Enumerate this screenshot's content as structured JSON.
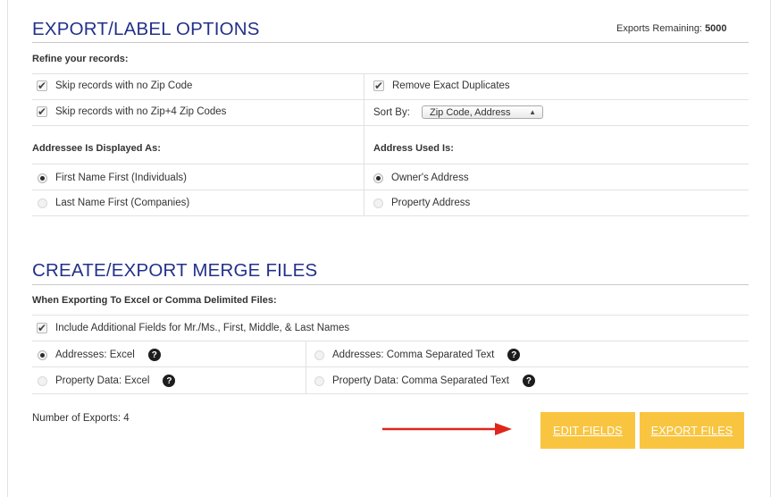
{
  "export_options": {
    "title": "EXPORT/LABEL OPTIONS",
    "exports_remaining_label": "Exports Remaining:",
    "exports_remaining_value": "5000",
    "refine_heading": "Refine your records:",
    "skip_no_zip": "Skip records with no Zip Code",
    "skip_no_zip4": "Skip records with no Zip+4 Zip Codes",
    "remove_duplicates": "Remove Exact Duplicates",
    "sort_by_label": "Sort By:",
    "sort_by_value": "Zip Code, Address",
    "addressee_heading": "Addressee Is Displayed As:",
    "first_name_first": "First Name First (Individuals)",
    "last_name_first": "Last Name First (Companies)",
    "address_used_heading": "Address Used Is:",
    "owners_address": "Owner's Address",
    "property_address": "Property Address"
  },
  "merge_files": {
    "title": "CREATE/EXPORT MERGE FILES",
    "subheading": "When Exporting To Excel or Comma Delimited Files:",
    "include_fields": "Include Additional Fields for Mr./Ms., First, Middle, & Last Names",
    "addresses_excel": "Addresses: Excel",
    "addresses_csv": "Addresses: Comma Separated Text",
    "property_excel": "Property Data: Excel",
    "property_csv": "Property Data: Comma Separated Text",
    "number_of_exports": "Number of Exports: 4"
  },
  "buttons": {
    "edit_fields": "EDIT FIELDS",
    "export_files": "EXPORT FILES"
  },
  "icons": {
    "check": "checkmark-icon",
    "help": "question-icon",
    "arrow": "red-arrow-icon",
    "select_chevron": "updown-chevron-icon"
  },
  "colors": {
    "heading_blue": "#22318a",
    "button_yellow": "#f9c540",
    "arrow_red": "#e0261b"
  }
}
